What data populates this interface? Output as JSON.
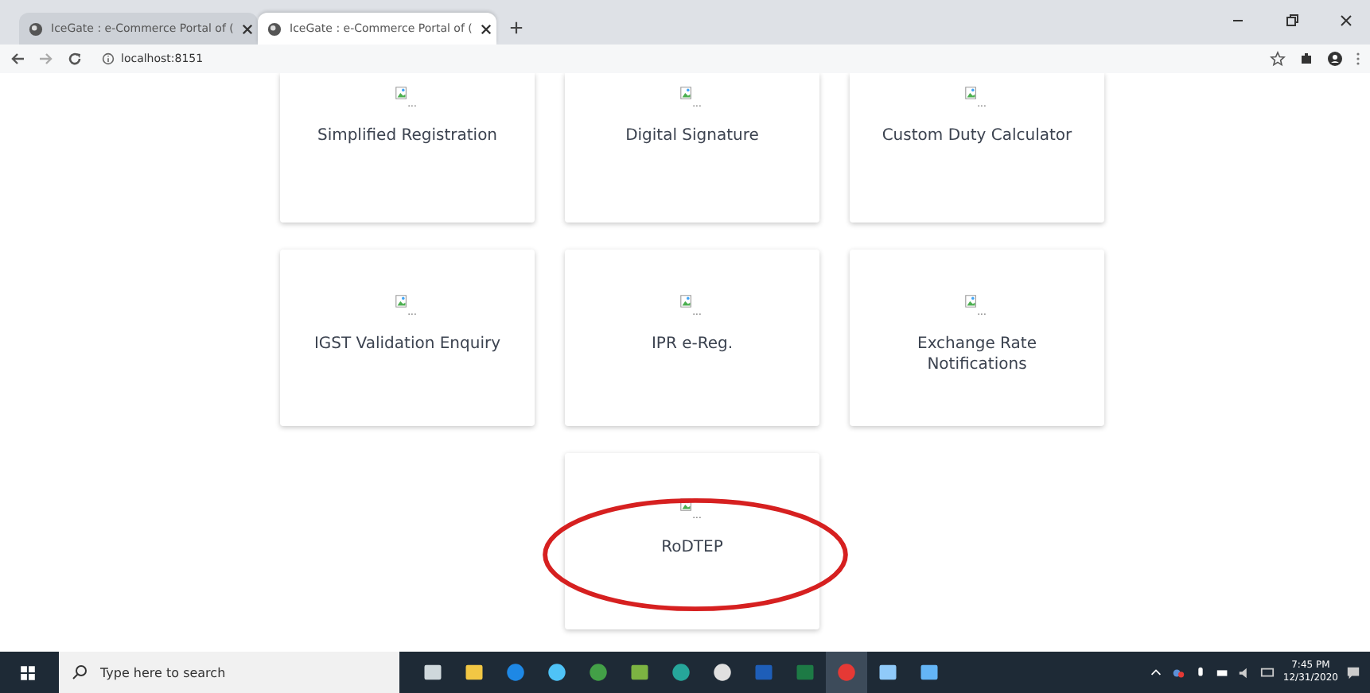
{
  "browser": {
    "tabs": [
      {
        "title": "IceGate : e-Commerce Portal of (",
        "selected": false
      },
      {
        "title": "IceGate : e-Commerce Portal of (",
        "selected": true
      }
    ],
    "url": "localhost:8151"
  },
  "cards": [
    {
      "title": "Simplified Registration",
      "alt": "...",
      "highlighted": false
    },
    {
      "title": "Digital Signature",
      "alt": "...",
      "highlighted": false
    },
    {
      "title": "Custom Duty Calculator",
      "alt": "...",
      "highlighted": false
    },
    {
      "title": "IGST Validation Enquiry",
      "alt": "...",
      "highlighted": false
    },
    {
      "title": "IPR e-Reg.",
      "alt": "...",
      "highlighted": false
    },
    {
      "title": "Exchange Rate Notifications",
      "alt": "...",
      "highlighted": false
    },
    {
      "title": "RoDTEP",
      "alt": "...",
      "highlighted": true
    }
  ],
  "taskbar": {
    "search_placeholder": "Type here to search",
    "time": "7:45 PM",
    "date": "12/31/2020"
  }
}
